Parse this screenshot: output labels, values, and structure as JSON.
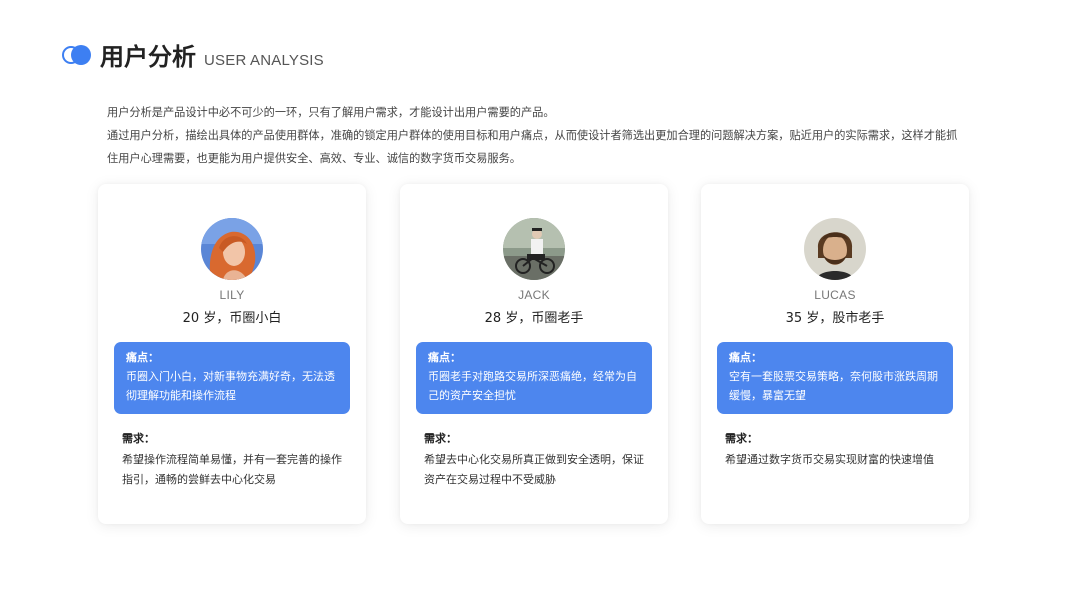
{
  "header": {
    "title_cn": "用户分析",
    "title_en": "USER ANALYSIS"
  },
  "intro": {
    "lines": [
      "用户分析是产品设计中必不可少的一环，只有了解用户需求，才能设计出用户需要的产品。",
      "通过用户分析，描绘出具体的产品使用群体，准确的锁定用户群体的使用目标和用户痛点，从而使设计者筛选出更加合理的问题解决方案，贴近用户的实际需求，这样才能抓",
      "住用户心理需要，也更能为用户提供安全、高效、专业、诚信的数字货币交易服务。"
    ]
  },
  "colors": {
    "accent": "#4d86ee",
    "logo": "#3d7ff2"
  },
  "cards": [
    {
      "name": "LILY",
      "profile": "20 岁，币圈小白",
      "pain_label": "痛点：",
      "pain_text": "币圈入门小白，对新事物充满好奇，无法透彻理解功能和操作流程",
      "need_label": "需求：",
      "need_text": "希望操作流程简单易懂，并有一套完善的操作指引，通畅的尝鲜去中心化交易"
    },
    {
      "name": "JACK",
      "profile": "28 岁，币圈老手",
      "pain_label": "痛点：",
      "pain_text": "币圈老手对跑路交易所深恶痛绝，经常为自己的资产安全担忧",
      "need_label": "需求：",
      "need_text": "希望去中心化交易所真正做到安全透明，保证资产在交易过程中不受威胁"
    },
    {
      "name": "LUCAS",
      "profile": "35 岁，股市老手",
      "pain_label": "痛点：",
      "pain_text": "空有一套股票交易策略，奈何股市涨跌周期缓慢，暴富无望",
      "need_label": "需求：",
      "need_text": "希望通过数字货币交易实现财富的快速增值"
    }
  ]
}
